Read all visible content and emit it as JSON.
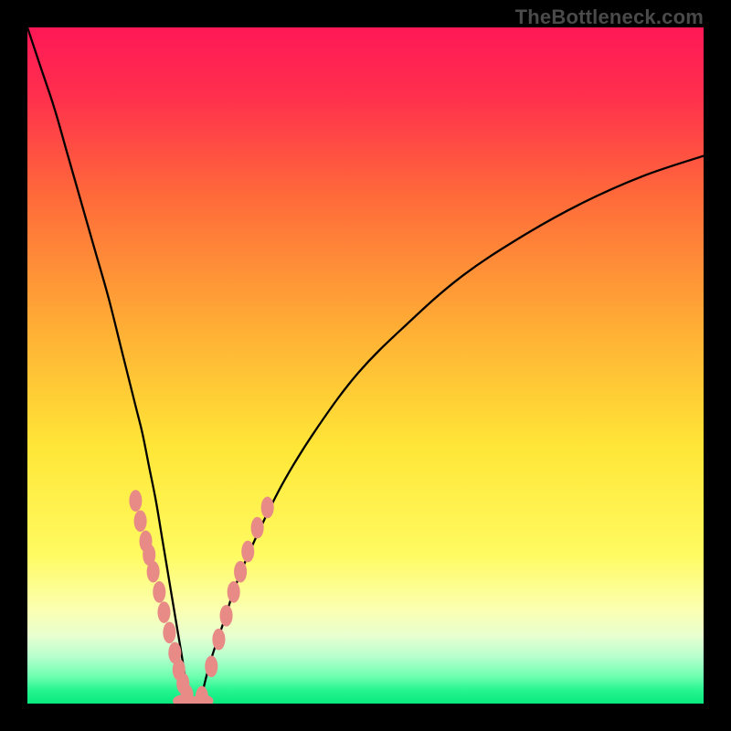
{
  "watermark": "TheBottleneck.com",
  "chart_data": {
    "type": "line",
    "title": "",
    "xlabel": "",
    "ylabel": "",
    "xlim": [
      0,
      100
    ],
    "ylim": [
      0,
      100
    ],
    "gradient_stops": [
      {
        "pct": 0,
        "color": "#ff1857"
      },
      {
        "pct": 10,
        "color": "#ff2f4d"
      },
      {
        "pct": 25,
        "color": "#ff6a3a"
      },
      {
        "pct": 45,
        "color": "#ffb035"
      },
      {
        "pct": 62,
        "color": "#ffe637"
      },
      {
        "pct": 78,
        "color": "#fffb61"
      },
      {
        "pct": 86,
        "color": "#fbffb0"
      },
      {
        "pct": 90,
        "color": "#e8ffd0"
      },
      {
        "pct": 93,
        "color": "#b8ffce"
      },
      {
        "pct": 96,
        "color": "#6effb0"
      },
      {
        "pct": 98,
        "color": "#27f591"
      },
      {
        "pct": 100,
        "color": "#09e97c"
      }
    ],
    "series": [
      {
        "name": "left-branch",
        "x": [
          0,
          2,
          4,
          6,
          8,
          10,
          12,
          14,
          16,
          17,
          18,
          19,
          20,
          21,
          22,
          23,
          23.8
        ],
        "y": [
          100,
          94,
          88,
          81,
          74,
          67,
          60,
          52,
          44,
          40,
          35,
          30,
          24,
          18,
          12,
          6,
          0
        ]
      },
      {
        "name": "right-branch",
        "x": [
          25.5,
          27,
          29,
          31,
          34,
          38,
          43,
          49,
          56,
          64,
          73,
          82,
          91,
          100
        ],
        "y": [
          0,
          6,
          12,
          18,
          25,
          33,
          41,
          49,
          56,
          63,
          69,
          74,
          78,
          81
        ]
      }
    ],
    "markers_left": {
      "name": "left-markers",
      "color": "#e88b87",
      "x": [
        16.0,
        16.7,
        17.5,
        18.0,
        18.6,
        19.5,
        20.2,
        21.0,
        21.8,
        22.4,
        23.0,
        23.6
      ],
      "y": [
        30.0,
        27.0,
        24.0,
        22.0,
        19.5,
        16.5,
        13.5,
        10.5,
        7.5,
        5.0,
        3.0,
        1.2
      ]
    },
    "markers_right": {
      "name": "right-markers",
      "color": "#e88b87",
      "x": [
        25.8,
        27.2,
        28.3,
        29.4,
        30.5,
        31.5,
        32.6,
        34.0,
        35.5
      ],
      "y": [
        1.0,
        5.5,
        9.5,
        13.0,
        16.5,
        19.5,
        22.5,
        26.0,
        29.0
      ]
    },
    "markers_bottom": {
      "name": "bottom-markers",
      "color": "#e88b87",
      "x": [
        23.0,
        24.0,
        25.0,
        26.0
      ],
      "y": [
        0.4,
        0.2,
        0.2,
        0.4
      ]
    }
  }
}
